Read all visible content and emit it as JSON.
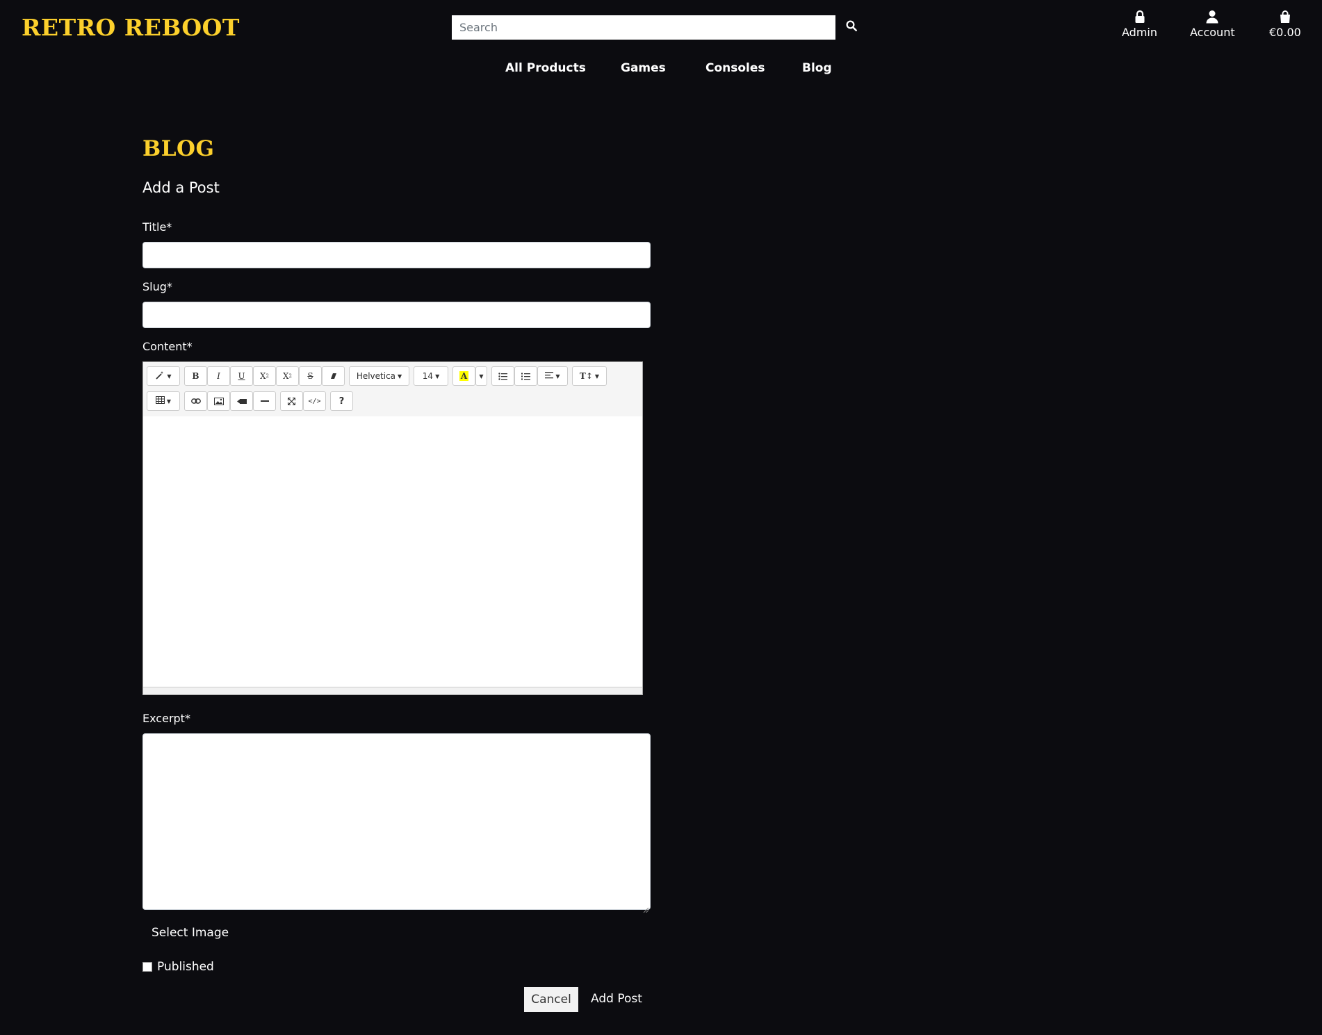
{
  "header": {
    "logo": "RETRO REBOOT",
    "search_placeholder": "Search",
    "admin_label": "Admin",
    "account_label": "Account",
    "cart_total": "€0.00"
  },
  "nav": {
    "items": [
      "All Products",
      "Games",
      "Consoles",
      "Blog"
    ]
  },
  "page": {
    "heading": "BLOG",
    "subheading": "Add a Post"
  },
  "form": {
    "title_label": "Title*",
    "slug_label": "Slug*",
    "content_label": "Content*",
    "excerpt_label": "Excerpt*",
    "select_image": "Select Image",
    "published_label": "Published",
    "published_checked": false,
    "cancel_label": "Cancel",
    "submit_label": "Add Post"
  },
  "editor": {
    "font_name": "Helvetica",
    "font_size": "14",
    "highlight_color": "#ffff00"
  },
  "colors": {
    "background": "#0c0c10",
    "brand": "#fcd02c",
    "text": "#ffffff"
  }
}
